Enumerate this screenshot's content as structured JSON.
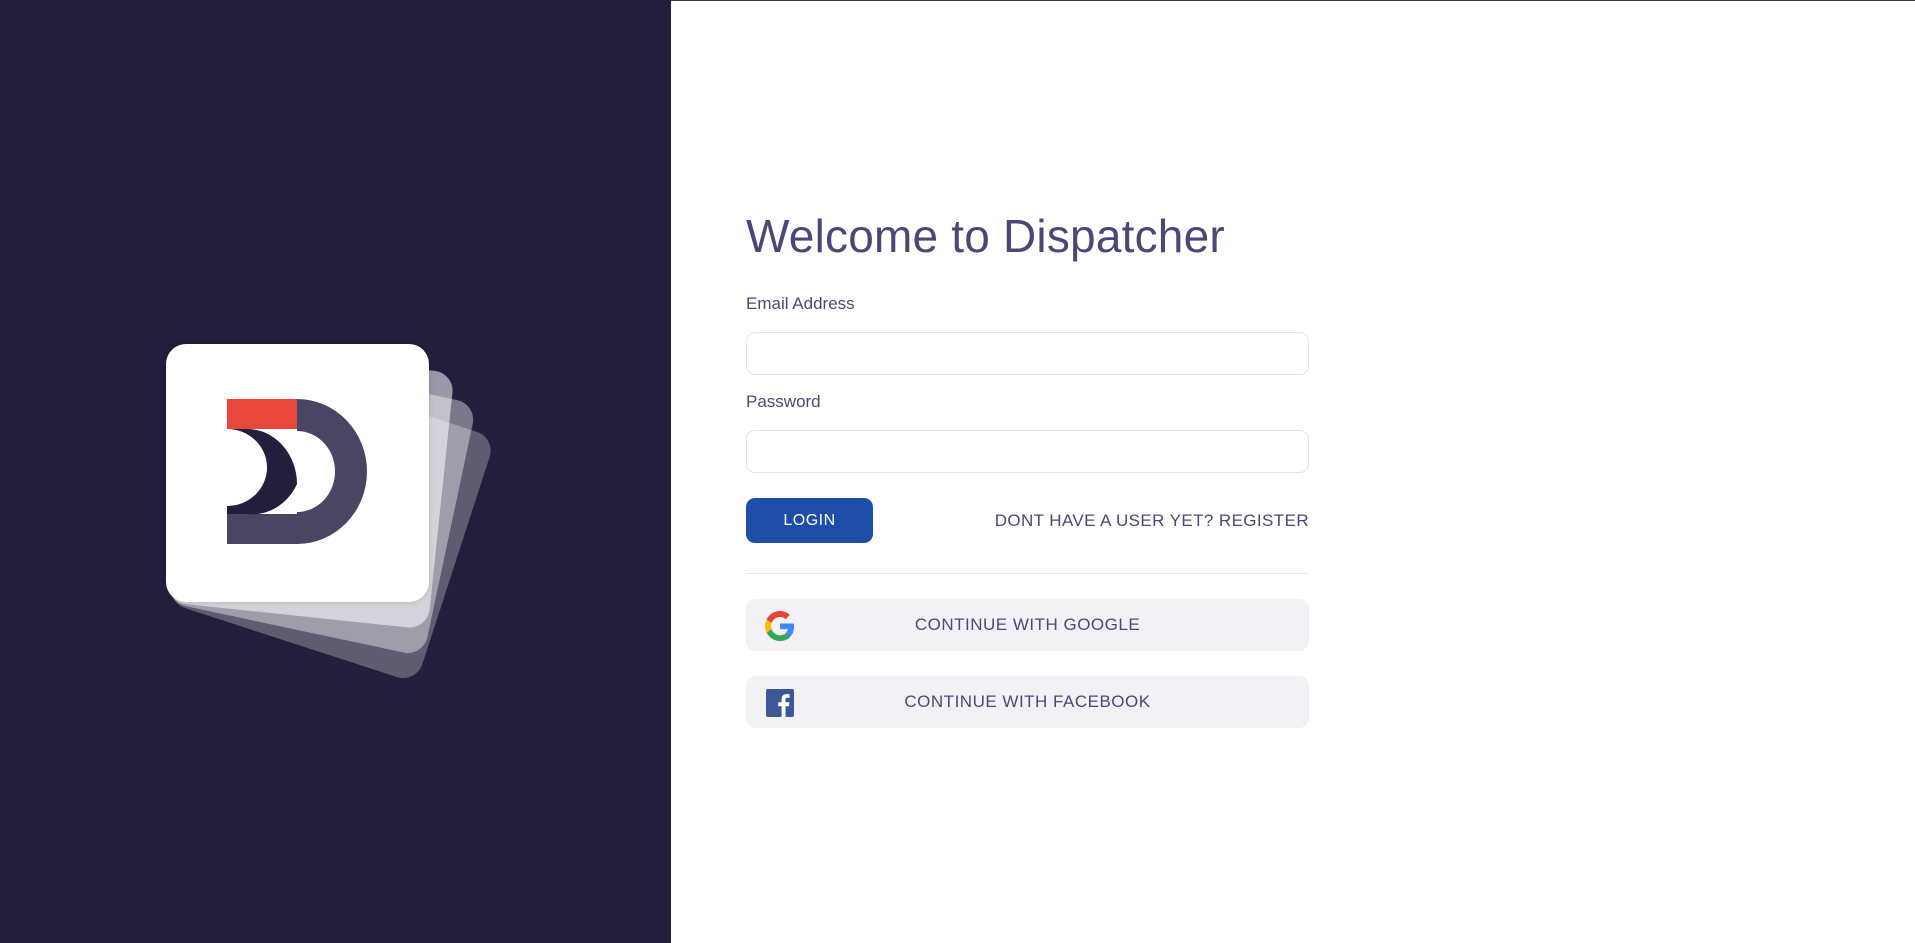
{
  "login_form": {
    "title": "Welcome to Dispatcher",
    "email_label": "Email Address",
    "email_value": "",
    "password_label": "Password",
    "password_value": "",
    "login_button": "LOGIN",
    "register_link": "DONT HAVE A USER YET? REGISTER"
  },
  "social": {
    "google_button": "CONTINUE WITH GOOGLE",
    "facebook_button": "CONTINUE WITH FACEBOOK",
    "google_icon": "google-icon",
    "facebook_icon": "facebook-icon"
  },
  "brand": {
    "logo_icon": "dispatcher-logo-icon",
    "panel_color": "#221e3c",
    "accent_red": "#e8473b",
    "logo_dark": "#221e3c",
    "logo_mid": "#4a4563",
    "primary_button_color": "#1e4da8",
    "text_color": "#4a4878"
  }
}
